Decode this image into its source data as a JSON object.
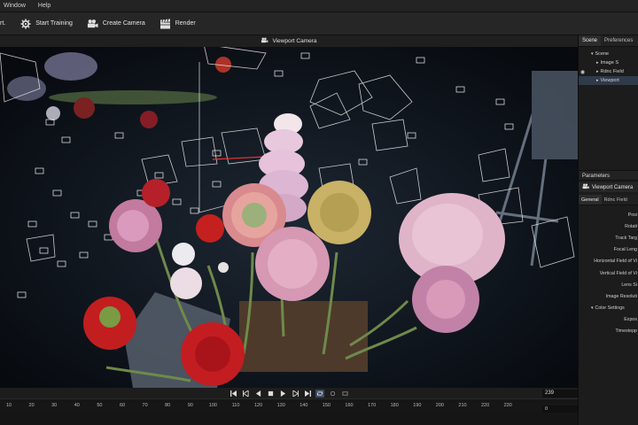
{
  "menu": {
    "items": [
      {
        "label": "Window"
      },
      {
        "label": "Help"
      }
    ]
  },
  "toolbar": {
    "truncated_label": "rt.",
    "start_training": "Start Training",
    "create_camera": "Create Camera",
    "render": "Render"
  },
  "viewport": {
    "title": "Viewport Camera"
  },
  "playback": {
    "frame_total": "239",
    "buttons": [
      "skip-start",
      "prev-key",
      "step-back",
      "stop",
      "play",
      "next-key",
      "skip-end",
      "loop"
    ]
  },
  "timeline": {
    "ticks": [
      "10",
      "20",
      "30",
      "40",
      "50",
      "60",
      "70",
      "80",
      "90",
      "100",
      "110",
      "120",
      "130",
      "140",
      "150",
      "160",
      "170",
      "180",
      "190",
      "200",
      "210",
      "220",
      "230"
    ],
    "current_frame": "0"
  },
  "scene_panel": {
    "tabs": [
      "Scene",
      "Preferences"
    ],
    "tree": [
      {
        "label": "Scene"
      },
      {
        "label": "Image S"
      },
      {
        "label": "Rdnc Field"
      },
      {
        "label": "Viewport"
      }
    ]
  },
  "params_panel": {
    "header": "Parameters",
    "object": "Viewport Camera",
    "tabs": [
      "General",
      "Rdnc Field"
    ],
    "properties": [
      "Posi",
      "Rotati",
      "Track Targ",
      "Focal Leng",
      "Horizontal Field of Vi",
      "Vertical Field of Vi",
      "Lens Si",
      "Image Resoluti",
      "Color Settings",
      "Expos",
      "Timestepp"
    ]
  },
  "colors": {
    "accent": "#3d4c63",
    "background": "#1a1a1a",
    "viewport_bg": "#0e141c"
  }
}
